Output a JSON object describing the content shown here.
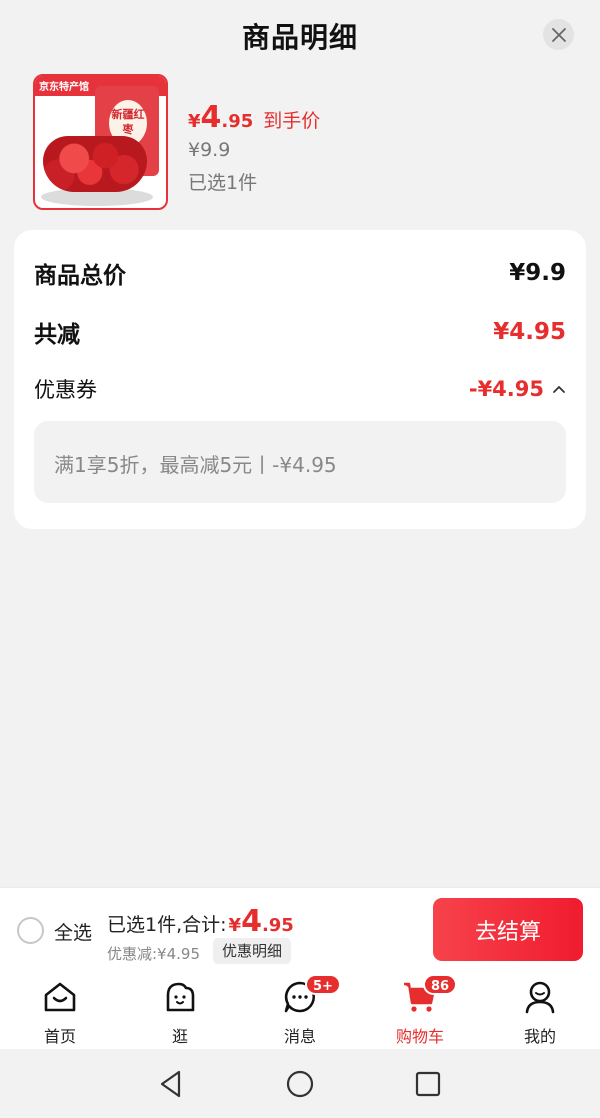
{
  "header": {
    "title": "商品明细",
    "close_icon": "close-icon"
  },
  "product": {
    "thumb_brand": "京东特产馆",
    "thumb_label": "新疆红枣",
    "price_currency": "¥",
    "price_int": "4",
    "price_dec": ".95",
    "price_tag": "到手价",
    "original_price": "¥9.9",
    "selected": "已选1件"
  },
  "breakdown": {
    "total_label": "商品总价",
    "total_value": "¥9.9",
    "reduce_label": "共减",
    "reduce_value": "¥4.95",
    "coupon_label": "优惠券",
    "coupon_value": "-¥4.95",
    "coupon_detail": "满1享5折，最高减5元丨-¥4.95"
  },
  "checkout": {
    "select_all": "全选",
    "total_label": "已选1件,合计:",
    "total_currency": "¥",
    "total_int": "4",
    "total_dec": ".95",
    "discount": "优惠减:¥4.95",
    "detail_chip": "优惠明细",
    "button": "去结算"
  },
  "tabs": [
    {
      "label": "首页",
      "icon": "home-icon"
    },
    {
      "label": "逛",
      "icon": "stroll-icon"
    },
    {
      "label": "消息",
      "icon": "message-icon",
      "badge": "5+"
    },
    {
      "label": "购物车",
      "icon": "cart-icon",
      "badge": "86",
      "active": true
    },
    {
      "label": "我的",
      "icon": "profile-icon"
    }
  ],
  "colors": {
    "accent": "#e62e2e",
    "background": "#f2f2f2"
  }
}
